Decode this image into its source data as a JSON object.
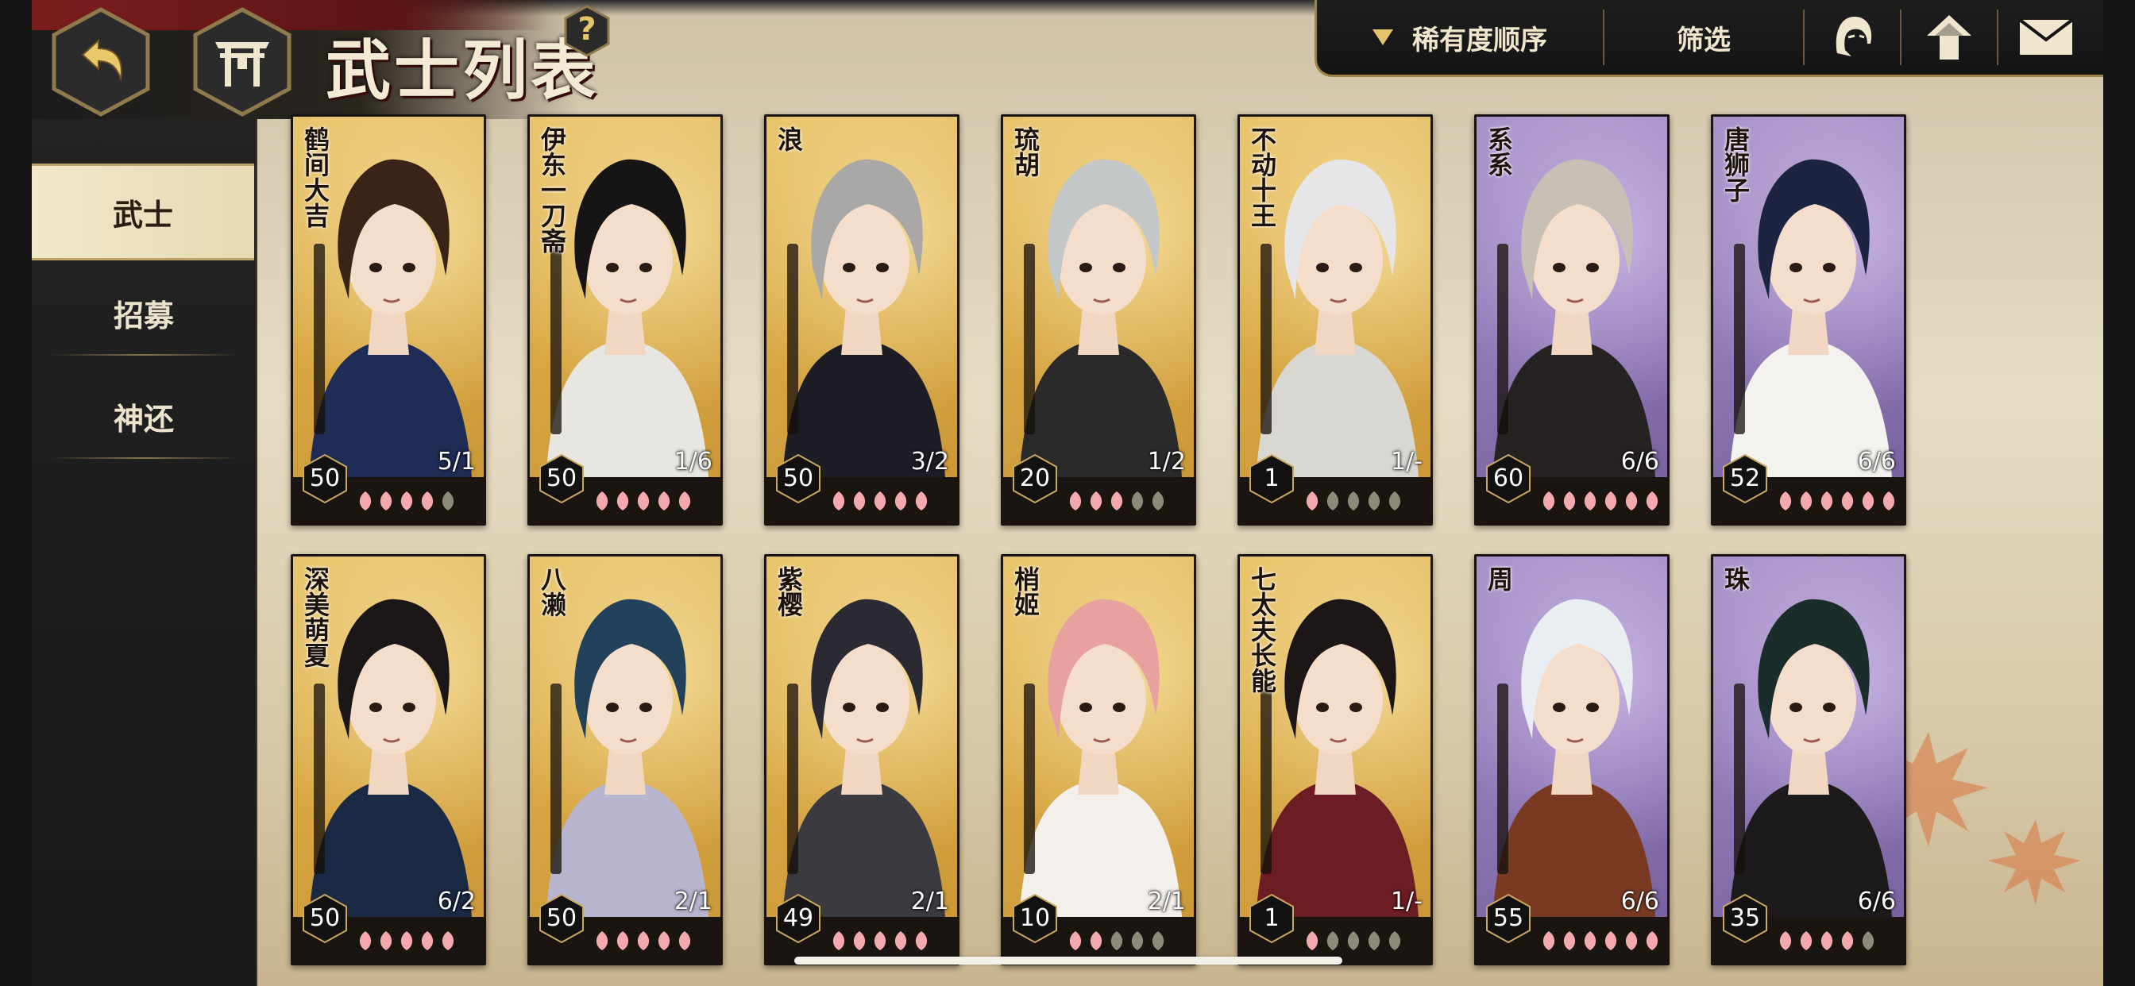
{
  "header": {
    "title": "武士列表",
    "help_label": "?"
  },
  "toolbar": {
    "sort_label": "稀有度顺序",
    "filter_label": "筛选",
    "icons": [
      "character-face-icon",
      "upload-arrow-icon",
      "mail-icon"
    ]
  },
  "sidebar": {
    "items": [
      {
        "label": "武士",
        "active": true
      },
      {
        "label": "招募",
        "active": false
      },
      {
        "label": "神还",
        "active": false
      }
    ]
  },
  "colors": {
    "gold_card": "#d8a844",
    "purple_card": "#8c76b4",
    "petal_on": "#f4a9ae",
    "petal_off": "#8c8a78"
  },
  "cards": [
    {
      "name": "鹤间大吉",
      "level": "50",
      "count": "5/1",
      "rarity": "gold",
      "petals": 5,
      "filled": 4,
      "hair": "#3a2418",
      "coat": "#1f2c55"
    },
    {
      "name": "伊东一刀斋",
      "level": "50",
      "count": "1/6",
      "rarity": "gold",
      "petals": 5,
      "filled": 5,
      "hair": "#161414",
      "coat": "#e8e6e0"
    },
    {
      "name": "浪",
      "level": "50",
      "count": "3/2",
      "rarity": "gold",
      "petals": 5,
      "filled": 5,
      "hair": "#a9a8a6",
      "coat": "#1d1d26"
    },
    {
      "name": "琉胡",
      "level": "20",
      "count": "1/2",
      "rarity": "gold",
      "petals": 5,
      "filled": 3,
      "hair": "#c4c7c7",
      "coat": "#2a2a2a"
    },
    {
      "name": "不动十王",
      "level": "1",
      "count": "1/-",
      "rarity": "gold",
      "petals": 5,
      "filled": 1,
      "hair": "#e6e6e8",
      "coat": "#d9d7d2"
    },
    {
      "name": "系系",
      "level": "60",
      "count": "6/6",
      "rarity": "purple",
      "petals": 6,
      "filled": 6,
      "hair": "#c7c0b4",
      "coat": "#262221"
    },
    {
      "name": "唐狮子",
      "level": "52",
      "count": "6/6",
      "rarity": "purple",
      "petals": 6,
      "filled": 6,
      "hair": "#1d2442",
      "coat": "#f4f2ee"
    },
    {
      "name": "深美萌夏",
      "level": "50",
      "count": "6/2",
      "rarity": "gold",
      "petals": 5,
      "filled": 5,
      "hair": "#1b1716",
      "coat": "#1b2a44"
    },
    {
      "name": "八濑",
      "level": "50",
      "count": "2/1",
      "rarity": "gold",
      "petals": 5,
      "filled": 5,
      "hair": "#24415c",
      "coat": "#b8b6cf"
    },
    {
      "name": "紫樱",
      "level": "49",
      "count": "2/1",
      "rarity": "gold",
      "petals": 5,
      "filled": 5,
      "hair": "#2b2a33",
      "coat": "#3a3a40"
    },
    {
      "name": "梢姬",
      "level": "10",
      "count": "2/1",
      "rarity": "gold",
      "petals": 5,
      "filled": 2,
      "hair": "#e7a2a0",
      "coat": "#f3efea"
    },
    {
      "name": "七太夫长能",
      "level": "1",
      "count": "1/-",
      "rarity": "gold",
      "petals": 5,
      "filled": 1,
      "hair": "#1c1616",
      "coat": "#6e1c24"
    },
    {
      "name": "周",
      "level": "55",
      "count": "6/6",
      "rarity": "purple",
      "petals": 6,
      "filled": 6,
      "hair": "#e9eef2",
      "coat": "#7a3a22"
    },
    {
      "name": "珠",
      "level": "35",
      "count": "6/6",
      "rarity": "purple",
      "petals": 5,
      "filled": 4,
      "hair": "#1a2d2b",
      "coat": "#1d1a1b"
    }
  ]
}
